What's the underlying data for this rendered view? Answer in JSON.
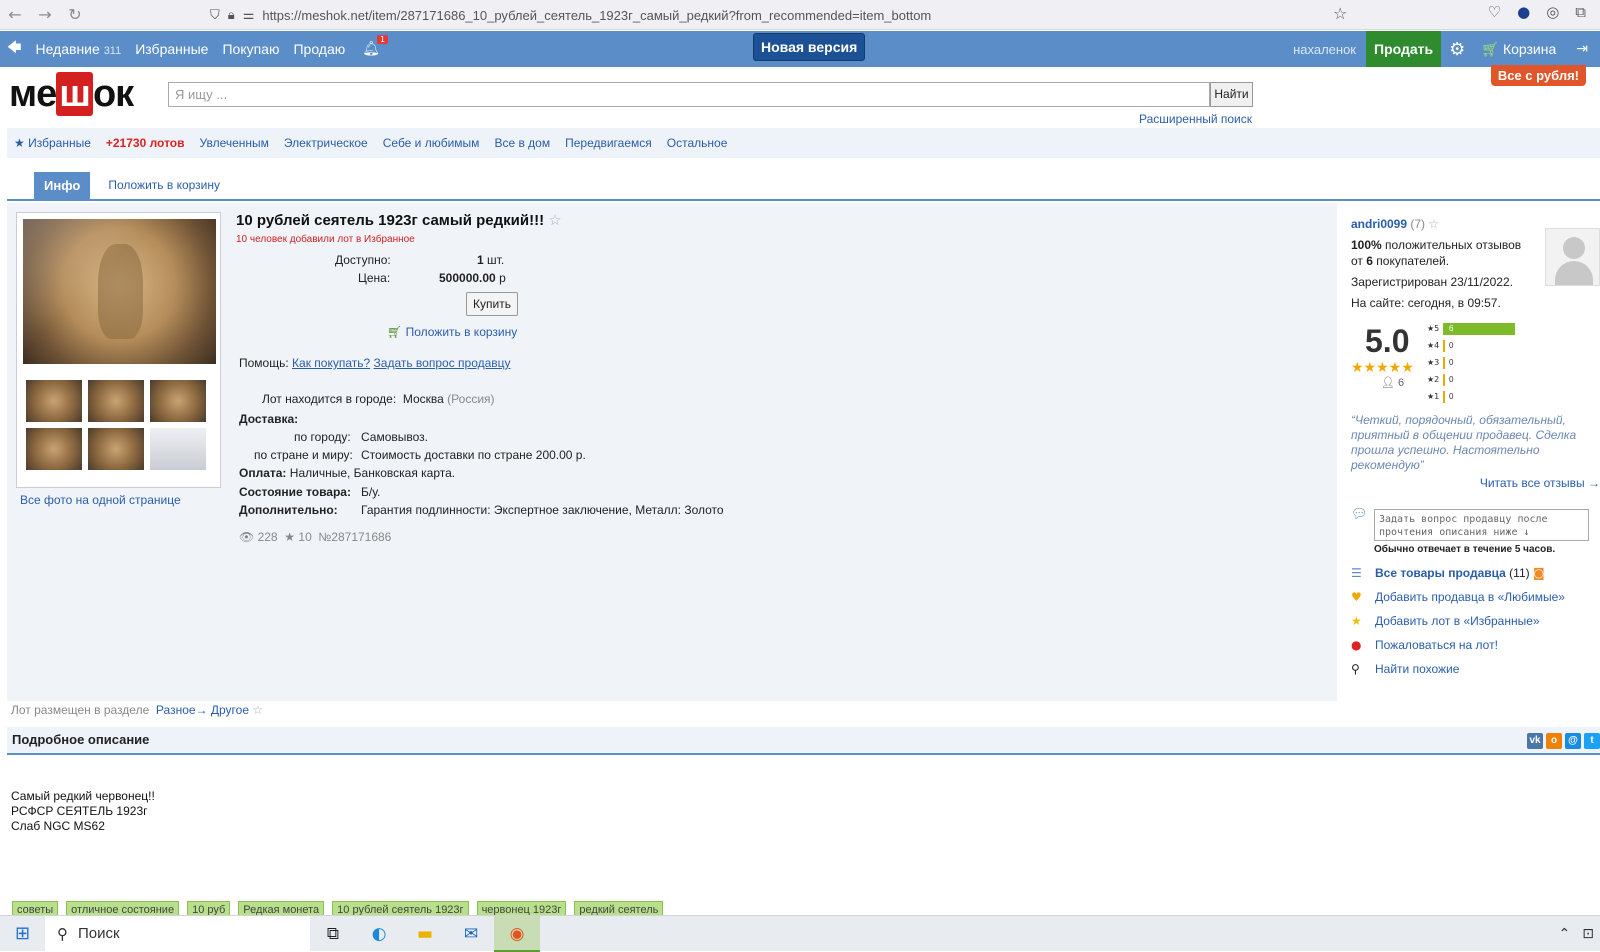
{
  "browser": {
    "url": "https://meshok.net/item/287171686_10_рублей_сеятель_1923г_самый_редкий?from_recommended=item_bottom"
  },
  "topbar": {
    "recent_label": "Недавние",
    "recent_count": "311",
    "favorites_label": "Избранные",
    "buying_label": "Покупаю",
    "selling_label": "Продаю",
    "notifications_badge": "1",
    "new_version_label": "Новая версия",
    "username": "нахаленок",
    "sell_label": "Продать",
    "cart_label": "Корзина",
    "all_from_ruble": "Все с рубля!"
  },
  "logo": {
    "pre": "ме",
    "mid": "ш",
    "post": "ок"
  },
  "search": {
    "placeholder": "Я ищу ...",
    "button_label": "Найти",
    "advanced_label": "Расширенный поиск"
  },
  "categories": {
    "favorites": "Избранные",
    "hot": "+21730 лотов",
    "items": [
      "Увлеченным",
      "Электрическое",
      "Себе и любимым",
      "Все в дом",
      "Передвигаемся",
      "Остальное"
    ]
  },
  "tabs": {
    "info": "Инфо",
    "put_in_cart": "Положить в корзину"
  },
  "lot": {
    "title": "10 рублей сеятель 1923г самый редкий!!!",
    "favorited_note": "10 человек добавили лот в Избранное",
    "available_label": "Доступно:",
    "available_value": "1",
    "available_unit": "шт.",
    "price_label": "Цена:",
    "price_value": "500000.00",
    "price_unit": "р",
    "buy_label": "Купить",
    "put_cart_label": "Положить в корзину",
    "help_label": "Помощь:",
    "help_how": "Как покупать?",
    "help_ask": "Задать вопрос продавцу",
    "city_label": "Лот находится в городе:",
    "city": "Москва",
    "country": "(Россия)",
    "delivery_label": "Доставка:",
    "city_delivery_label": "по городу:",
    "city_delivery": "Самовывоз.",
    "country_delivery_label": "по стране и миру:",
    "country_delivery": "Стоимость доставки по стране 200.00 р.",
    "payment_label": "Оплата:",
    "payment": "Наличные, Банковская карта.",
    "condition_label": "Состояние товара:",
    "condition": "Б/у.",
    "extra_label": "Дополнительно:",
    "extra": "Гарантия подлинности: Экспертное заключение, Металл: Золото",
    "views": "228",
    "favs": "10",
    "lot_number": "№287171686",
    "all_photos": "Все фото на одной странице"
  },
  "seller": {
    "name": "andri0099",
    "count": "(7)",
    "positive_pct": "100%",
    "positive_text": "положительных отзывов от",
    "buyers_num": "6",
    "buyers_text": "покупателей.",
    "registered": "Зарегистрирован 23/11/2022.",
    "online": "На сайте: сегодня, в 09:57.",
    "rating": "5.0",
    "stars": "★★★★★",
    "reviewers": "6",
    "distribution": [
      {
        "label": "★5",
        "count": "6",
        "fraction": 1.0
      },
      {
        "label": "★4",
        "count": "0",
        "fraction": 0
      },
      {
        "label": "★3",
        "count": "0",
        "fraction": 0
      },
      {
        "label": "★2",
        "count": "0",
        "fraction": 0
      },
      {
        "label": "★1",
        "count": "0",
        "fraction": 0
      }
    ],
    "quote": "“Четкий, порядочный, обязательный, приятный в общении продавец. Сделка прошла успешно. Настоятельно рекомендую”",
    "read_all": "Читать все отзывы →",
    "ask_placeholder": "Задать вопрос продавцу после прочтения описания ниже ↓",
    "response_time": "Обычно отвечает в течение 5 часов.",
    "all_items": "Все товары продавца",
    "all_items_count": "(11)",
    "add_favorite_seller": "Добавить продавца в «Любимые»",
    "add_favorite_lot": "Добавить лот в «Избранные»",
    "report": "Пожаловаться на лот!",
    "find_similar": "Найти похожие"
  },
  "section": {
    "label": "Лот размещен в разделе",
    "path": "Разное→ Другое"
  },
  "description": {
    "title": "Подробное описание",
    "lines": [
      "Самый редкий червонец!!",
      "РСФСР СЕЯТЕЛЬ 1923г",
      "Слаб NGC MS62"
    ]
  },
  "tags": [
    "советы",
    "отличное состояние",
    "10 руб",
    "Редкая монета",
    "10 рублей сеятель 1923г",
    "червонец 1923г",
    "редкий сеятель"
  ],
  "taskbar": {
    "search_label": "Поиск"
  },
  "colors": {
    "brand_blue": "#5b8dc8",
    "sell_green": "#2e8b2e",
    "hot_red": "#d22222"
  }
}
